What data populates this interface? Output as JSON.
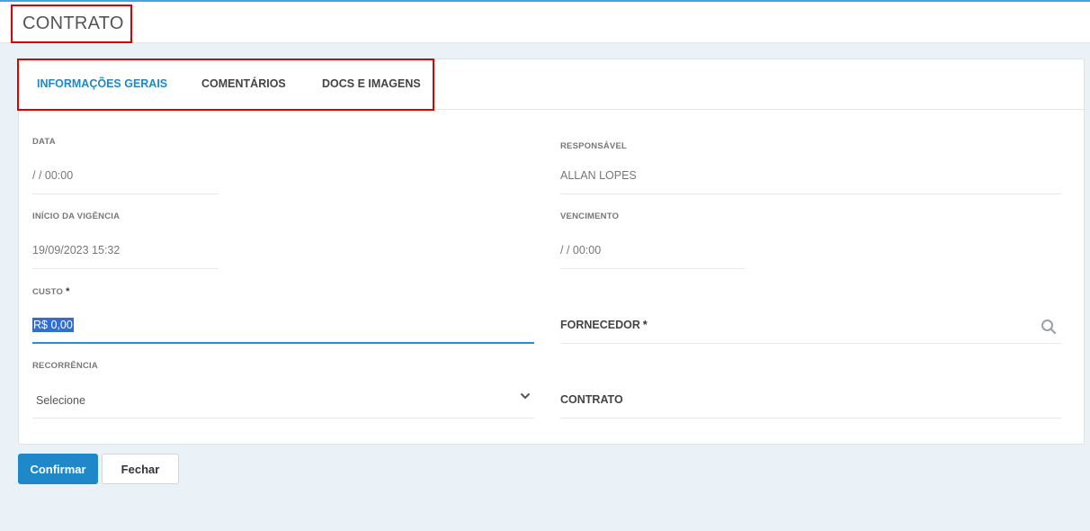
{
  "page": {
    "title": "CONTRATO"
  },
  "tabs": [
    {
      "label": "INFORMAÇÕES GERAIS",
      "active": true
    },
    {
      "label": "COMENTÁRIOS",
      "active": false
    },
    {
      "label": "DOCS E IMAGENS",
      "active": false
    }
  ],
  "form": {
    "data": {
      "label": "DATA",
      "value": "/ / 00:00"
    },
    "responsavel": {
      "label": "RESPONSÁVEL",
      "value": "ALLAN LOPES"
    },
    "inicio_vigencia": {
      "label": "INÍCIO DA VIGÊNCIA",
      "value": "19/09/2023 15:32"
    },
    "vencimento": {
      "label": "VENCIMENTO",
      "value": "/ / 00:00"
    },
    "custo": {
      "label": "CUSTO",
      "required_mark": "*",
      "value": "R$ 0,00"
    },
    "fornecedor": {
      "label": "FORNECEDOR",
      "required_mark": "*"
    },
    "recorrencia": {
      "label": "RECORRÊNCIA",
      "value": "Selecione"
    },
    "contrato": {
      "label": "CONTRATO"
    }
  },
  "buttons": {
    "confirm": "Confirmar",
    "close": "Fechar"
  },
  "colors": {
    "accent": "#1e88c8",
    "highlight_box": "#e00000",
    "background": "#eaf1f7"
  }
}
